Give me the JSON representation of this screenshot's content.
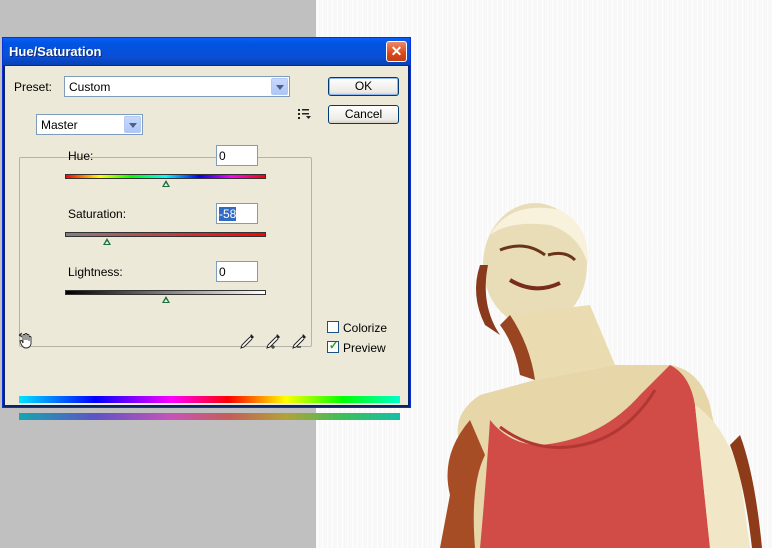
{
  "dialog": {
    "title": "Hue/Saturation",
    "close_glyph": "✕",
    "preset_label": "Preset:",
    "preset_value": "Custom",
    "ok_label": "OK",
    "cancel_label": "Cancel",
    "channel_value": "Master",
    "hue": {
      "label": "Hue:",
      "value": "0",
      "slider_position": 0.5
    },
    "saturation": {
      "label": "Saturation:",
      "value": "-58",
      "slider_position": 0.21
    },
    "lightness": {
      "label": "Lightness:",
      "value": "0",
      "slider_position": 0.5
    },
    "colorize": {
      "label": "Colorize",
      "checked": false
    },
    "preview": {
      "label": "Preview",
      "checked": true
    },
    "icons": [
      "preset-menu-icon",
      "targeted-adjustment-hand-icon",
      "eyedropper-icon",
      "eyedropper-add-icon",
      "eyedropper-subtract-icon"
    ]
  },
  "colors": {
    "titlebar": "#0054e3",
    "dialog_bg": "#ece9d8",
    "shirt": "#d14b47",
    "canvas_grey": "#c0c0c0"
  }
}
